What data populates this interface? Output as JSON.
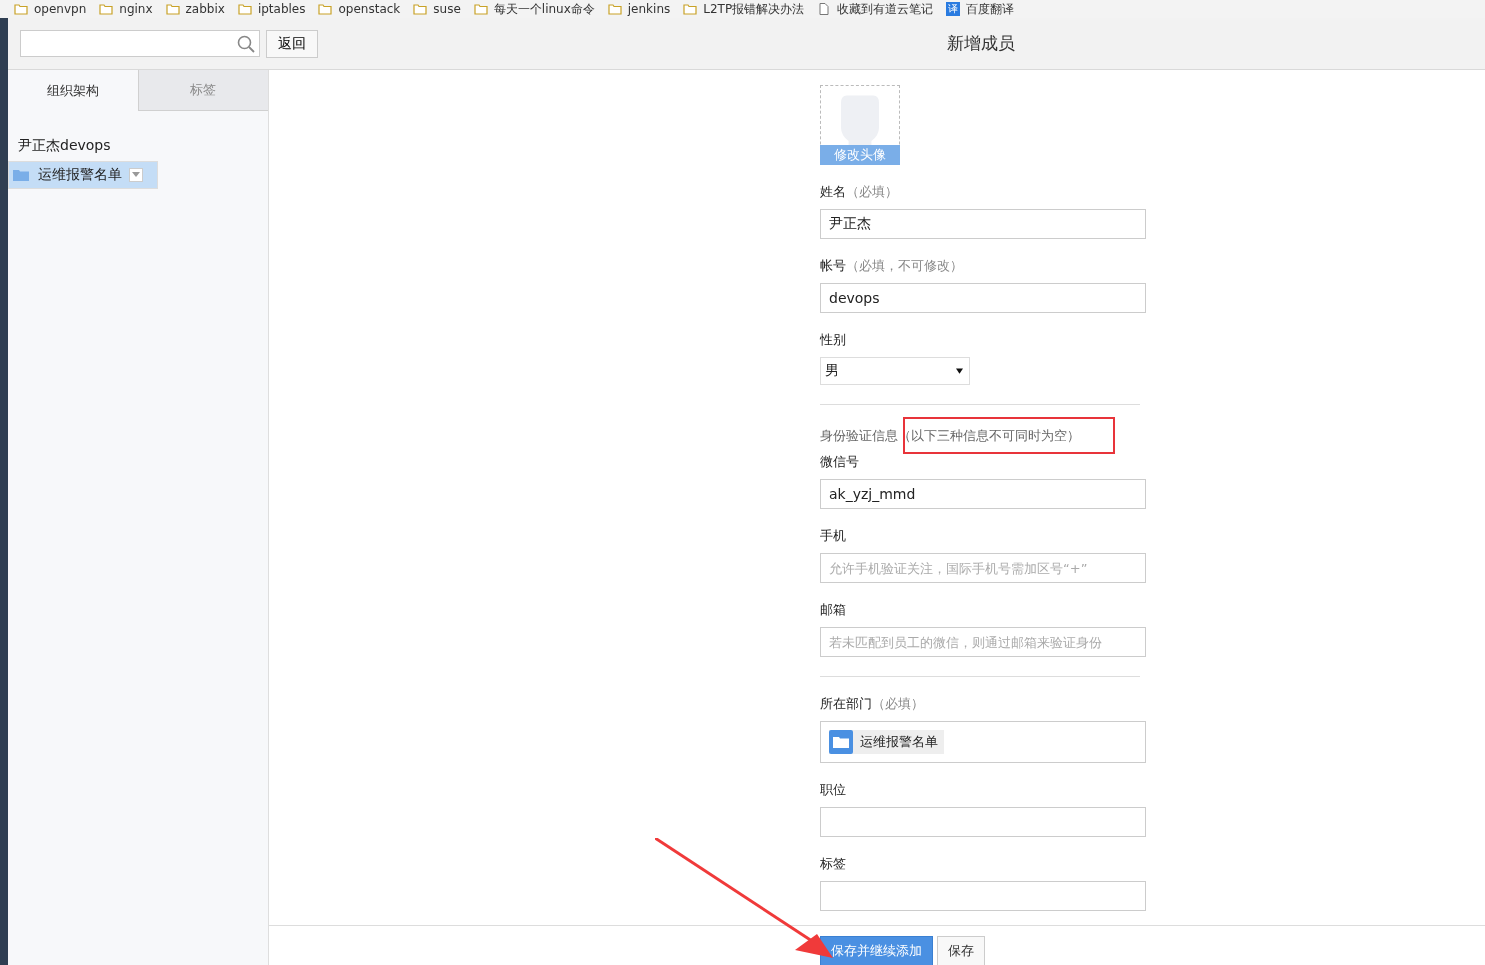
{
  "bookmarks": [
    {
      "label": "openvpn",
      "kind": "folder"
    },
    {
      "label": "nginx",
      "kind": "folder"
    },
    {
      "label": "zabbix",
      "kind": "folder"
    },
    {
      "label": "iptables",
      "kind": "folder"
    },
    {
      "label": "openstack",
      "kind": "folder"
    },
    {
      "label": "suse",
      "kind": "folder"
    },
    {
      "label": "每天一个linux命令",
      "kind": "folder"
    },
    {
      "label": "jenkins",
      "kind": "folder"
    },
    {
      "label": "L2TP报错解决办法",
      "kind": "folder"
    },
    {
      "label": "收藏到有道云笔记",
      "kind": "page"
    },
    {
      "label": "百度翻译",
      "kind": "translate",
      "icon_text": "译"
    }
  ],
  "toolbar": {
    "back_button": "返回",
    "title": "新增成员"
  },
  "sidebar": {
    "tabs": [
      {
        "label": "组织架构",
        "selected": true
      },
      {
        "label": "标签",
        "selected": false
      }
    ],
    "tree": {
      "label": "尹正杰devops",
      "children": [
        {
          "label": "运维报警名单",
          "selected": true
        }
      ]
    }
  },
  "avatar": {
    "button": "修改头像"
  },
  "fields": [
    {
      "kind": "text",
      "label": "姓名",
      "hint": "（必填）",
      "value": "尹正杰"
    },
    {
      "kind": "text",
      "label": "帐号",
      "hint": "（必填，不可修改）",
      "value": "devops"
    },
    {
      "kind": "select",
      "label": "性别",
      "value": "男"
    },
    {
      "kind": "divider"
    },
    {
      "kind": "section",
      "label": "身份验证信息",
      "hint": "（以下三种信息不可同时为空）"
    },
    {
      "kind": "text",
      "label": "微信号",
      "value": "ak_yzj_mmd"
    },
    {
      "kind": "text",
      "label": "手机",
      "placeholder": "允许手机验证关注，国际手机号需加区号“+”"
    },
    {
      "kind": "text",
      "label": "邮箱",
      "placeholder": "若未匹配到员工的微信，则通过邮箱来验证身份"
    },
    {
      "kind": "divider"
    },
    {
      "kind": "dept",
      "label": "所在部门",
      "hint": "（必填）",
      "value": "运维报警名单"
    },
    {
      "kind": "text",
      "label": "职位"
    },
    {
      "kind": "text",
      "label": "标签"
    }
  ],
  "buttons": [
    {
      "label": "保存并继续添加",
      "primary": true
    },
    {
      "label": "保存",
      "primary": false
    }
  ]
}
